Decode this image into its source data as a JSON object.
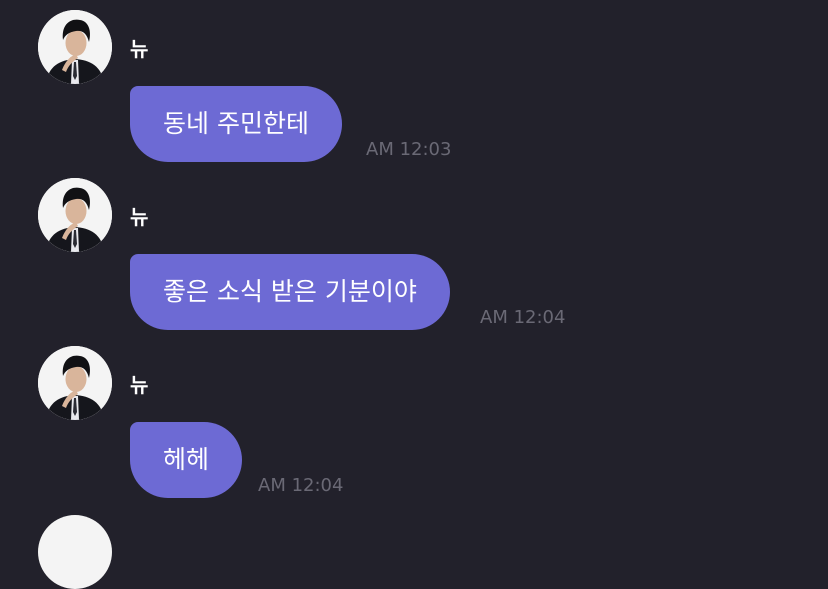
{
  "chat": {
    "messages": [
      {
        "sender": "뉴",
        "text": "동네 주민한테",
        "time": "AM 12:03"
      },
      {
        "sender": "뉴",
        "text": "좋은 소식 받은 기분이야",
        "time": "AM 12:04"
      },
      {
        "sender": "뉴",
        "text": "헤헤",
        "time": "AM 12:04"
      }
    ]
  },
  "colors": {
    "background": "#22212b",
    "bubble": "#6d6ad4",
    "timestamp": "#6a6975",
    "sender_text": "#ffffff"
  }
}
